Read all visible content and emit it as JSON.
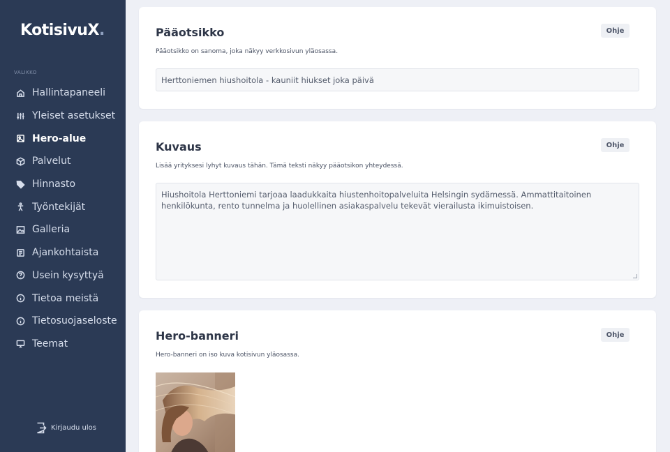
{
  "app": {
    "logo_text": "KotisivuX",
    "logo_dot": "."
  },
  "sidebar": {
    "section_label": "VALIKKO",
    "items": [
      {
        "label": "Hallintapaneeli",
        "icon": "home-icon",
        "active": false
      },
      {
        "label": "Yleiset asetukset",
        "icon": "sliders-icon",
        "active": false
      },
      {
        "label": "Hero-alue",
        "icon": "image-icon",
        "active": true
      },
      {
        "label": "Palvelut",
        "icon": "box-icon",
        "active": false
      },
      {
        "label": "Hinnasto",
        "icon": "tag-icon",
        "active": false
      },
      {
        "label": "Työntekijät",
        "icon": "person-icon",
        "active": false
      },
      {
        "label": "Galleria",
        "icon": "gallery-icon",
        "active": false
      },
      {
        "label": "Ajankohtaista",
        "icon": "news-icon",
        "active": false
      },
      {
        "label": "Usein kysyttyä",
        "icon": "question-icon",
        "active": false
      },
      {
        "label": "Tietoa meistä",
        "icon": "info-icon",
        "active": false
      },
      {
        "label": "Tietosuojaseloste",
        "icon": "info-icon",
        "active": false
      },
      {
        "label": "Teemat",
        "icon": "monitor-icon",
        "active": false
      }
    ],
    "logout_label": "Kirjaudu ulos"
  },
  "cards": {
    "headline": {
      "title": "Pääotsikko",
      "help_label": "Ohje",
      "description": "Pääotsikko on sanoma, joka näkyy verkkosivun yläosassa.",
      "value": "Herttoniemen hiushoitola - kauniit hiukset joka päivä"
    },
    "description": {
      "title": "Kuvaus",
      "help_label": "Ohje",
      "description": "Lisää yrityksesi lyhyt kuvaus tähän. Tämä teksti näkyy pääotsikon yhteydessä.",
      "value": "Hiushoitola Herttoniemi tarjoaa laadukkaita hiustenhoitopalveluita Helsingin sydämessä. Ammattitaitoinen henkilökunta, rento tunnelma ja huolellinen asiakaspalvelu tekevät vierailusta ikimuistoisen."
    },
    "banner": {
      "title": "Hero-banneri",
      "help_label": "Ohje",
      "description": "Hero-banneri on iso kuva kotisivun yläosassa."
    }
  },
  "colors": {
    "sidebar_bg": "#2b3a55",
    "page_bg": "#eef0f6",
    "card_bg": "#ffffff"
  }
}
